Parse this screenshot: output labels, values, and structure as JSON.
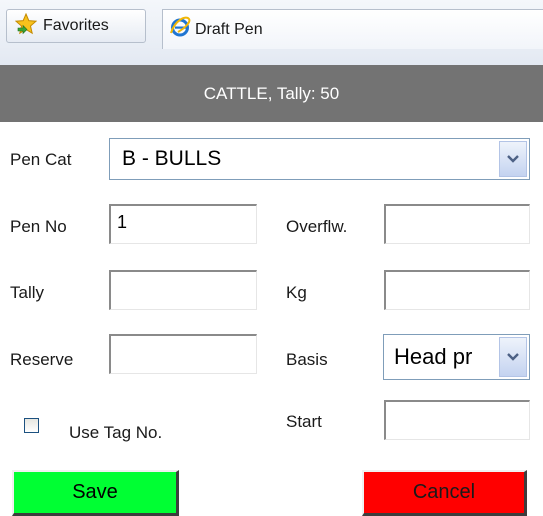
{
  "browser": {
    "favorites_label": "Favorites",
    "tab_title": "Draft Pen"
  },
  "header": {
    "title": "CATTLE, Tally: 50"
  },
  "form": {
    "pen_cat": {
      "label": "Pen Cat",
      "value": "B - BULLS"
    },
    "pen_no": {
      "label": "Pen No",
      "value": "1"
    },
    "overflow": {
      "label": "Overflw.",
      "value": ""
    },
    "tally": {
      "label": "Tally",
      "value": ""
    },
    "kg": {
      "label": "Kg",
      "value": ""
    },
    "reserve": {
      "label": "Reserve",
      "value": ""
    },
    "basis": {
      "label": "Basis",
      "value": "Head pr"
    },
    "use_tag": {
      "label": "Use Tag No.",
      "checked": false
    },
    "start": {
      "label": "Start",
      "value": ""
    }
  },
  "buttons": {
    "save": "Save",
    "cancel": "Cancel"
  },
  "colors": {
    "header_bg": "#737373",
    "save_bg": "#00ff33",
    "cancel_bg": "#ff0000"
  },
  "icons": {
    "favorites": "star-icon",
    "tab": "ie-icon",
    "dropdown": "chevron-down-icon"
  }
}
